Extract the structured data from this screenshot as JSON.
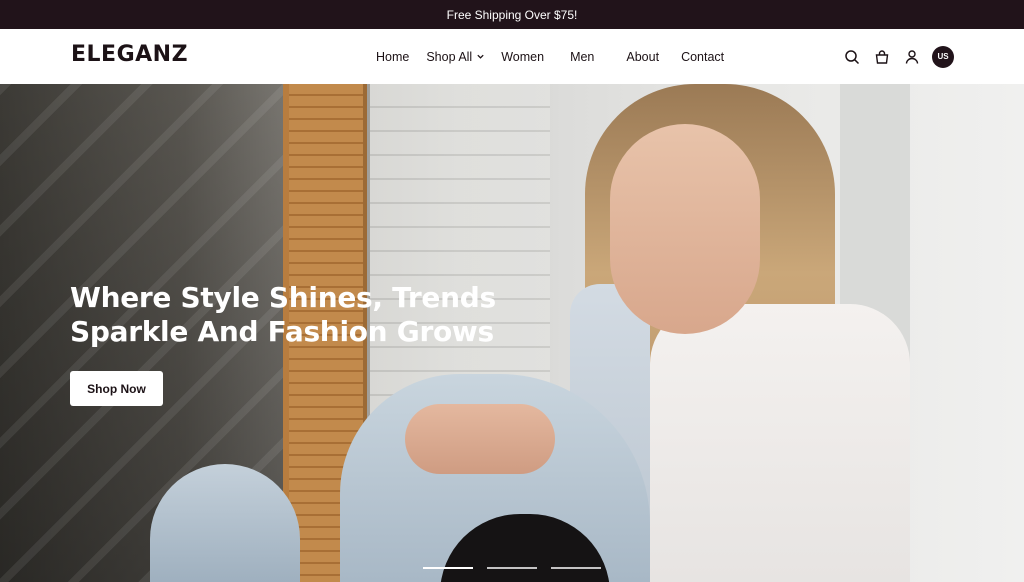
{
  "announcement": {
    "text": "Free Shipping Over $75!"
  },
  "header": {
    "logo": "ELEGANZ",
    "nav": [
      {
        "label": "Home"
      },
      {
        "label": "Shop All",
        "has_dropdown": true
      },
      {
        "label": "Women"
      },
      {
        "label": "Men"
      },
      {
        "label": "About"
      },
      {
        "label": "Contact"
      }
    ],
    "icons": [
      "search-icon",
      "bag-icon",
      "user-icon"
    ],
    "locale": "US"
  },
  "hero": {
    "title_line1": "Where Style Shines, Trends",
    "title_line2": "Sparkle And Fashion Grows",
    "cta": "Shop Now",
    "slides": 3,
    "active_slide": 1
  },
  "colors": {
    "dark": "#21131a",
    "white": "#ffffff"
  }
}
